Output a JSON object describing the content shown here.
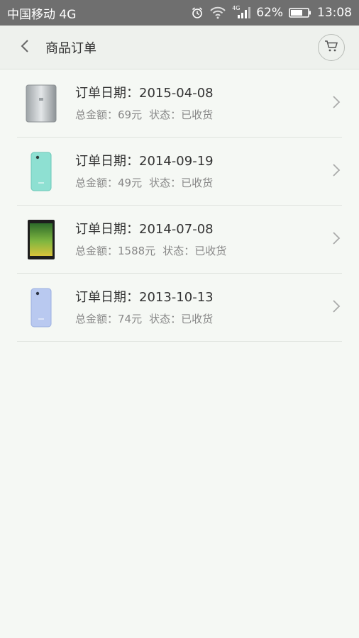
{
  "status_bar": {
    "carrier": "中国移动 4G",
    "network_badge": "4G",
    "battery": "62%",
    "time": "13:08"
  },
  "header": {
    "title": "商品订单"
  },
  "orders": [
    {
      "date": "订单日期：2015-04-08",
      "amount": "总金额：69元",
      "status": "状态：已收货",
      "thumb": "power-bank"
    },
    {
      "date": "订单日期：2014-09-19",
      "amount": "总金额：49元",
      "status": "状态：已收货",
      "thumb": "phone-case-mint"
    },
    {
      "date": "订单日期：2014-07-08",
      "amount": "总金额：1588元",
      "status": "状态：已收货",
      "thumb": "tablet"
    },
    {
      "date": "订单日期：2013-10-13",
      "amount": "总金额：74元",
      "status": "状态：已收货",
      "thumb": "phone-case-blue"
    }
  ]
}
